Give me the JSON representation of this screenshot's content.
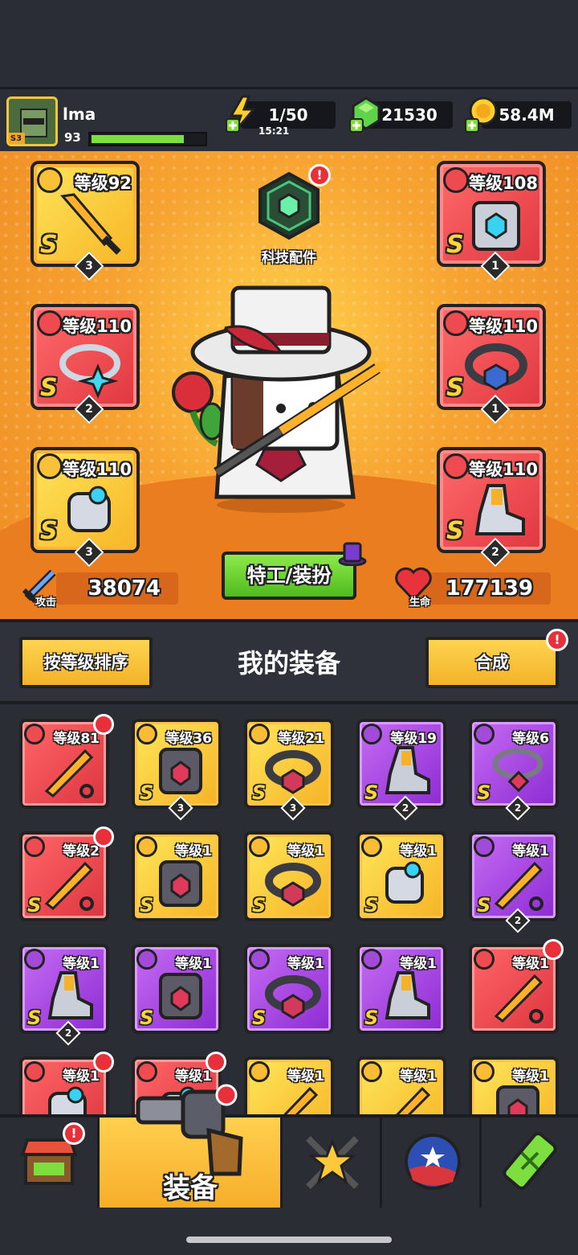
{
  "player": {
    "name": "lma",
    "level": "93",
    "season_badge": "S3",
    "xp_fraction": 0.82
  },
  "resources": {
    "energy": "1/50",
    "energy_timer": "15:21",
    "gems": "21530",
    "coins": "58.4M"
  },
  "tech": {
    "label": "科技配件",
    "alert": "!"
  },
  "equipped": {
    "weapon": {
      "level": "等级92",
      "rank": "S",
      "count": "3"
    },
    "armor": {
      "level": "等级108",
      "rank": "S",
      "count": "1"
    },
    "necklace": {
      "level": "等级110",
      "rank": "S",
      "count": "2"
    },
    "belt": {
      "level": "等级110",
      "rank": "S",
      "count": "1"
    },
    "glove": {
      "level": "等级110",
      "rank": "S",
      "count": "3"
    },
    "boots": {
      "level": "等级110",
      "rank": "S",
      "count": "2"
    }
  },
  "stats": {
    "attack_label": "攻击",
    "attack": "38074",
    "hp_label": "生命",
    "hp": "177139"
  },
  "agent_button": "特工/装扮",
  "inventory": {
    "title": "我的装备",
    "sort_button": "按等级排序",
    "merge_button": "合成",
    "merge_alert": "!",
    "items": [
      {
        "color": "red",
        "slot": "weapon",
        "level": "等级81",
        "rank": "",
        "count": "",
        "new": true
      },
      {
        "color": "gold",
        "slot": "armor",
        "level": "等级36",
        "rank": "S",
        "count": "3",
        "new": false
      },
      {
        "color": "gold",
        "slot": "belt",
        "level": "等级21",
        "rank": "S",
        "count": "3",
        "new": false
      },
      {
        "color": "purple",
        "slot": "boots",
        "level": "等级19",
        "rank": "S",
        "count": "2",
        "new": false
      },
      {
        "color": "purple",
        "slot": "necklace",
        "level": "等级6",
        "rank": "S",
        "count": "2",
        "new": false
      },
      {
        "color": "red",
        "slot": "weapon",
        "level": "等级2",
        "rank": "S",
        "count": "",
        "new": true
      },
      {
        "color": "gold",
        "slot": "armor",
        "level": "等级1",
        "rank": "S",
        "count": "",
        "new": false
      },
      {
        "color": "gold",
        "slot": "belt",
        "level": "等级1",
        "rank": "S",
        "count": "",
        "new": false
      },
      {
        "color": "gold",
        "slot": "glove",
        "level": "等级1",
        "rank": "S",
        "count": "",
        "new": false
      },
      {
        "color": "purple",
        "slot": "weapon",
        "level": "等级1",
        "rank": "S",
        "count": "2",
        "new": false
      },
      {
        "color": "purple",
        "slot": "boots",
        "level": "等级1",
        "rank": "S",
        "count": "2",
        "new": false
      },
      {
        "color": "purple",
        "slot": "armor",
        "level": "等级1",
        "rank": "S",
        "count": "",
        "new": false
      },
      {
        "color": "purple",
        "slot": "belt",
        "level": "等级1",
        "rank": "S",
        "count": "",
        "new": false
      },
      {
        "color": "purple",
        "slot": "boots",
        "level": "等级1",
        "rank": "S",
        "count": "",
        "new": false
      },
      {
        "color": "red",
        "slot": "weapon",
        "level": "等级1",
        "rank": "",
        "count": "",
        "new": true
      },
      {
        "color": "red",
        "slot": "glove",
        "level": "等级1",
        "rank": "",
        "count": "",
        "new": true
      },
      {
        "color": "red",
        "slot": "glove",
        "level": "等级1",
        "rank": "",
        "count": "",
        "new": true
      },
      {
        "color": "gold",
        "slot": "weapon",
        "level": "等级1",
        "rank": "",
        "count": "",
        "new": false
      },
      {
        "color": "gold",
        "slot": "weapon",
        "level": "等级1",
        "rank": "",
        "count": "",
        "new": false
      },
      {
        "color": "gold",
        "slot": "armor",
        "level": "等级1",
        "rank": "",
        "count": "",
        "new": false
      }
    ]
  },
  "nav": {
    "shop_alert": "!",
    "equip_label": "装备",
    "active": "equip"
  }
}
